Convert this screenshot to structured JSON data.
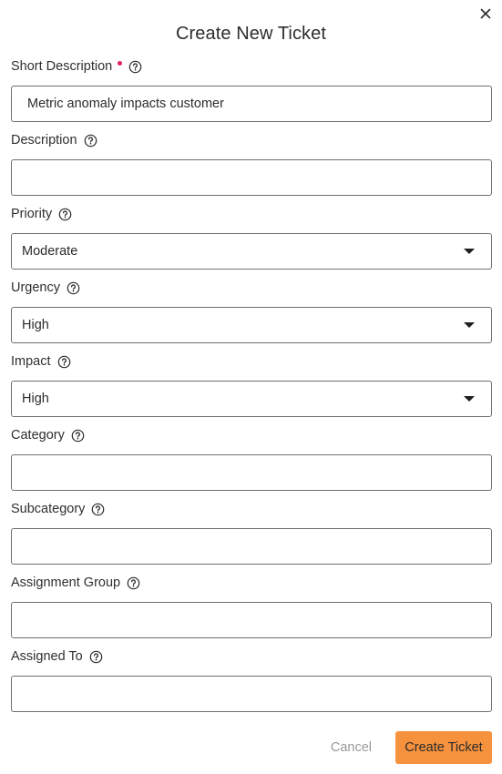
{
  "dialog": {
    "title": "Create New Ticket",
    "close_icon": "close-icon"
  },
  "fields": {
    "short_description": {
      "label": "Short Description",
      "required": true,
      "value": "Metric anomaly impacts customer",
      "help_icon": "help-circle-icon"
    },
    "description": {
      "label": "Description",
      "value": "",
      "help_icon": "help-circle-icon"
    },
    "priority": {
      "label": "Priority",
      "selected": "Moderate",
      "help_icon": "help-circle-icon"
    },
    "urgency": {
      "label": "Urgency",
      "selected": "High",
      "help_icon": "help-circle-icon"
    },
    "impact": {
      "label": "Impact",
      "selected": "High",
      "help_icon": "help-circle-icon"
    },
    "category": {
      "label": "Category",
      "value": "",
      "help_icon": "help-circle-icon"
    },
    "subcategory": {
      "label": "Subcategory",
      "value": "",
      "help_icon": "help-circle-icon"
    },
    "assignment_group": {
      "label": "Assignment Group",
      "value": "",
      "help_icon": "help-circle-icon"
    },
    "assigned_to": {
      "label": "Assigned To",
      "value": "",
      "help_icon": "help-circle-icon"
    }
  },
  "footer": {
    "cancel_label": "Cancel",
    "create_label": "Create Ticket"
  },
  "colors": {
    "accent": "#f6923d",
    "required_dot": "#e0245e",
    "border": "#6f6f6f",
    "muted_text": "#9a9a9a"
  }
}
